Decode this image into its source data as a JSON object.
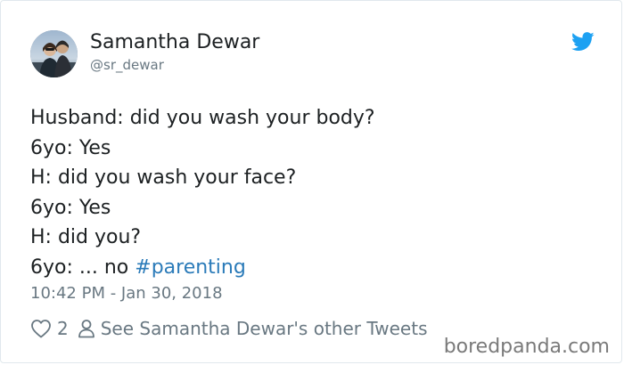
{
  "author": {
    "name": "Samantha Dewar",
    "handle": "@sr_dewar"
  },
  "icons": {
    "brand": "twitter-bird-icon",
    "like": "heart-icon",
    "profile": "person-icon"
  },
  "colors": {
    "text": "#1c2022",
    "secondary": "#697882",
    "hashtag": "#2b7bb9",
    "twitter_blue": "#1da1f2",
    "border": "#e1e8ed"
  },
  "tweet": {
    "lines": [
      "Husband: did you wash your body?",
      "6yo: Yes",
      "H: did you wash your face?",
      "6yo: Yes",
      "H: did you?",
      "6yo: ... no "
    ],
    "hashtag": "#parenting",
    "timestamp": "10:42 PM - Jan 30, 2018"
  },
  "actions": {
    "like_count": "2",
    "profile_link": "See Samantha Dewar's other Tweets"
  },
  "watermark": "boredpanda.com"
}
